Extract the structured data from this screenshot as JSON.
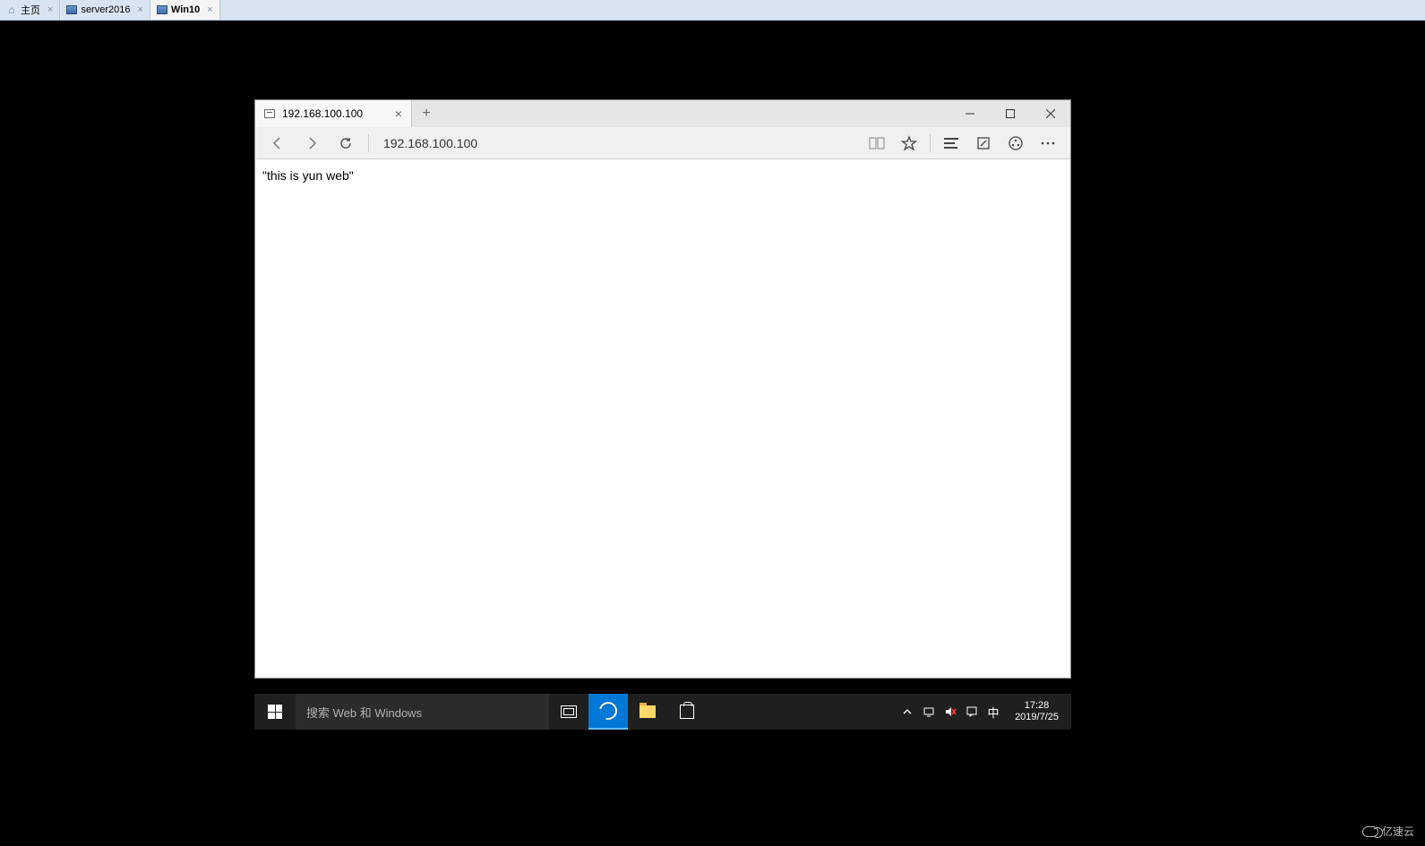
{
  "vm_tabs": {
    "home": "主页",
    "server": "server2016",
    "win10": "Win10"
  },
  "browser": {
    "tab_title": "192.168.100.100",
    "address": "192.168.100.100",
    "page_body": "\"this is yun web\""
  },
  "taskbar": {
    "search_placeholder": "搜索 Web 和 Windows",
    "ime": "中",
    "time": "17:28",
    "date": "2019/7/25"
  },
  "watermark": "亿速云"
}
